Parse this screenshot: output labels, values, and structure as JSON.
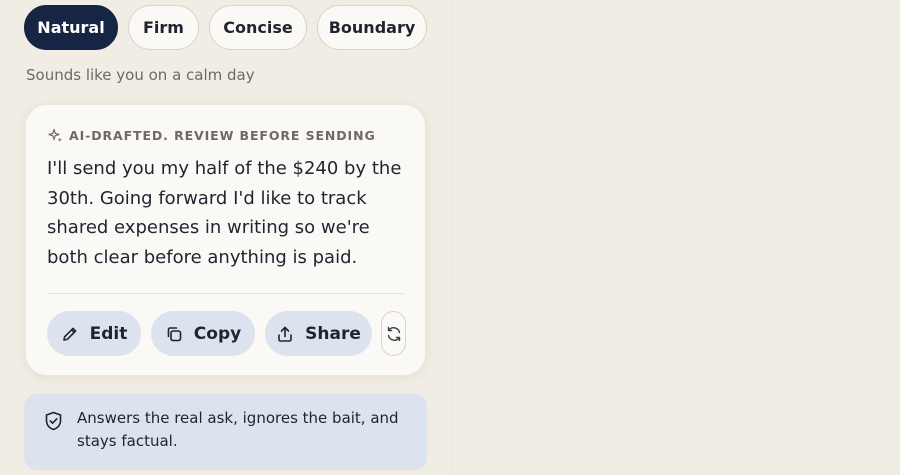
{
  "tones": [
    {
      "label": "Natural",
      "selected": true
    },
    {
      "label": "Firm",
      "selected": false
    },
    {
      "label": "Concise",
      "selected": false
    },
    {
      "label": "Boundary",
      "selected": false
    }
  ],
  "tone_description": "Sounds like you on a calm day",
  "draft": {
    "label": "AI-drafted. Review before sending",
    "body": "I'll send you my half of the $240 by the 30th. Going forward I'd like to track shared expenses in writing so we're both clear before anything is paid.",
    "icon": "sparkle-icon"
  },
  "actions": {
    "edit": {
      "label": "Edit",
      "icon": "pencil-icon"
    },
    "copy": {
      "label": "Copy",
      "icon": "copy-icon"
    },
    "share": {
      "label": "Share",
      "icon": "share-icon"
    },
    "regenerate": {
      "icon": "refresh-icon"
    }
  },
  "explanation": {
    "text": "Answers the real ask, ignores the bait, and stays factual.",
    "icon": "shield-check-icon"
  },
  "colors": {
    "background": "#f2ede4",
    "accent_navy": "#162544",
    "card": "#fbf9f5",
    "button_blue": "#dce3ee",
    "muted_text": "#6f6a61"
  }
}
